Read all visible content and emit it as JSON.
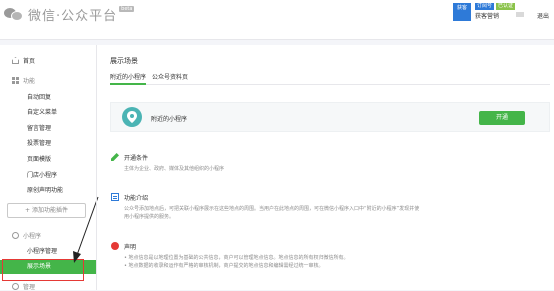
{
  "header": {
    "logo_text": "微信·公众平台",
    "logo_beta": "beta",
    "account_avatar_text": "获客",
    "account_badges": [
      "订阅号",
      "已认证"
    ],
    "account_name": "获客营销",
    "logout": "退出"
  },
  "sidebar": {
    "home": "首页",
    "function_group": "功能",
    "function_items": [
      "自动回复",
      "自定义菜单",
      "留言管理",
      "投票管理",
      "页面模版",
      "门店小程序",
      "原创声明功能"
    ],
    "add_plugin": "+ 添加功能插件",
    "mini_group": "小程序",
    "mini_items": [
      "小程序管理"
    ],
    "active_item": "展示场景",
    "manage_group": "管理"
  },
  "main": {
    "title": "展示场景",
    "tabs": [
      "附近的小程序",
      "公众号资料页"
    ],
    "banner_label": "附近的小程序",
    "open_button": "开通",
    "sections": [
      {
        "title": "开通条件",
        "desc": [
          "主体为企业、政府、媒体及其他组织的小程序"
        ]
      },
      {
        "title": "功能介绍",
        "desc": [
          "公众号添加地点后，可把关联小程序展示在这些地点的周围。当用户在此地点的周围，可在微信小程序入口中“附近的小程序”发现并使",
          "用小程序提供的服务。"
        ]
      },
      {
        "title": "声明",
        "desc": [
          "• 地点信息是以地理位置为基础的公共信息，商户可以管理地点信息。地点信息的所有权归微信所有。",
          "• 地点数据的收录和运作有严格的审核机制，商户提交的地点信息和编辑需经过统一审核。"
        ]
      }
    ]
  },
  "colors": {
    "accent_green": "#44b549",
    "annotation_red": "#e53935",
    "brand_blue": "#2e7ad8"
  }
}
